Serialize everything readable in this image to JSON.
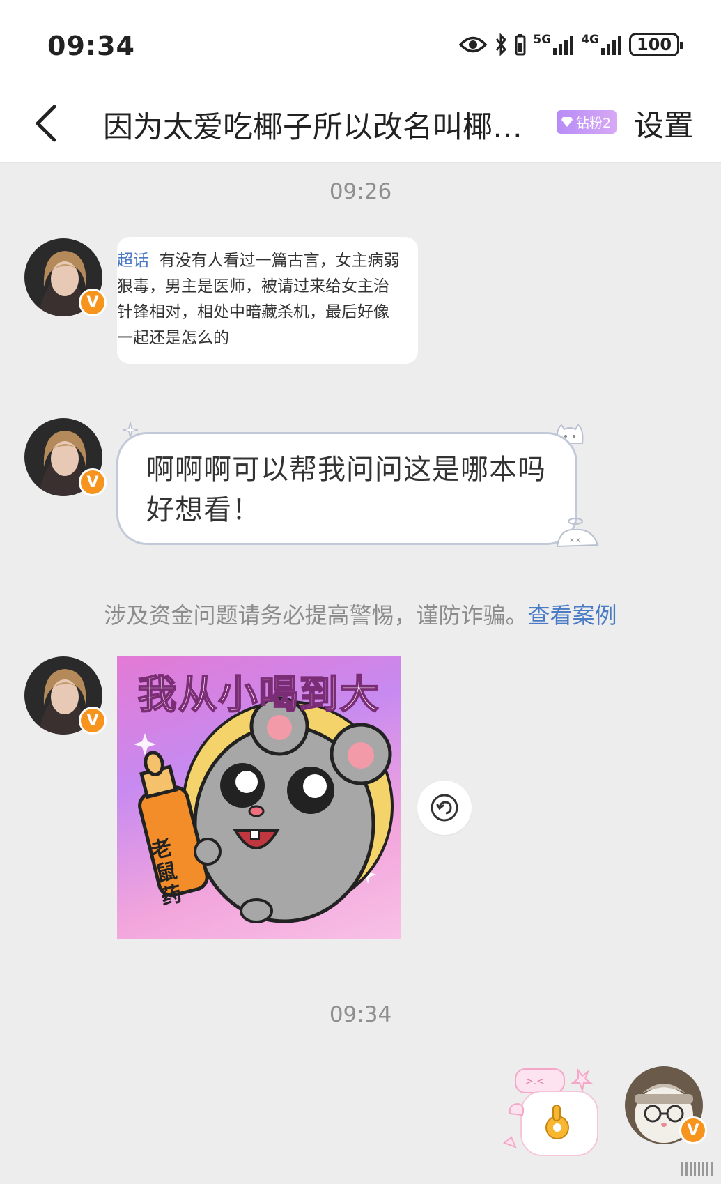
{
  "status_bar": {
    "time": "09:34",
    "net1": "5G",
    "net2": "4G",
    "battery": "100",
    "icons": [
      "eye-icon",
      "bluetooth-icon",
      "signal-5g-icon",
      "signal-4g-icon",
      "battery-icon"
    ]
  },
  "nav": {
    "title": "因为太爱吃椰子所以改名叫椰…",
    "fan_badge": "钻粉2",
    "settings": "设置"
  },
  "messages": {
    "time1": "09:26",
    "shared_post": {
      "tag": "超话",
      "line1": "有没有人看过一篇古言，女主病弱",
      "line2": "狠毒，男主是医师，被请过来给女主治",
      "line3": "针锋相对，相处中暗藏杀机，最后好像",
      "line4": "一起还是怎么的"
    },
    "text_msg": "啊啊啊可以帮我问问这是哪本吗 好想看！",
    "notice_text": "涉及资金问题请务必提高警惕，谨防诈骗。",
    "notice_link": "查看案例",
    "sticker_title": "我从小喝到大",
    "sticker_bottle": "老鼠药",
    "time2": "09:34",
    "verified_mark": "V"
  },
  "colors": {
    "background": "#ededed",
    "bubble_border": "#c2c9d8",
    "link": "#4a7bc4",
    "verified": "#f7941d",
    "badge": "#b78cf6"
  }
}
